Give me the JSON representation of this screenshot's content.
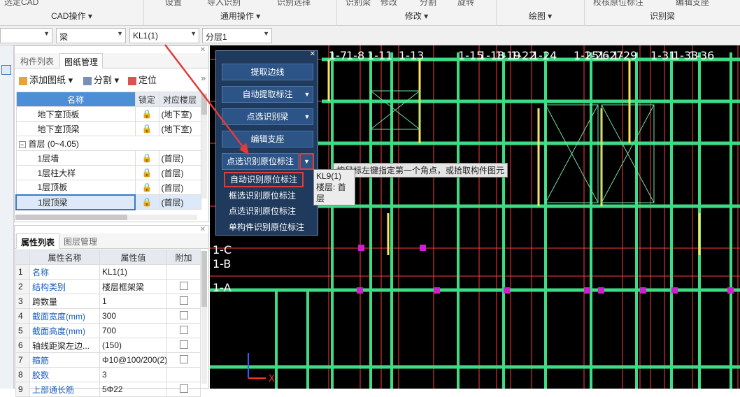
{
  "ribbon": {
    "top_labels": [
      "选定CAD",
      "设置",
      "导入识别",
      "识别选择",
      "识别梁",
      "修改",
      "分割",
      "旋转",
      "校核原位标注",
      "编辑支座"
    ],
    "groups": [
      {
        "label": "CAD操作"
      },
      {
        "label": "通用操作"
      },
      {
        "label": "修改"
      },
      {
        "label": "绘图"
      },
      {
        "label": "识别梁"
      }
    ]
  },
  "filter": {
    "floor": "",
    "type": "梁",
    "component": "KL1(1)",
    "layer": "分层1"
  },
  "drawing_panel": {
    "tabs": [
      "构件列表",
      "图纸管理"
    ],
    "toolbar": [
      "添加图纸",
      "分割",
      "定位"
    ],
    "headers": [
      "名称",
      "锁定",
      "对应楼层"
    ],
    "rows": [
      {
        "name": "地下室顶板",
        "floor": "(地下室)"
      },
      {
        "name": "地下室顶梁",
        "floor": "(地下室)"
      },
      {
        "name": "首层 (0~4.05)",
        "group": true
      },
      {
        "name": "1层墙",
        "floor": "(首层)"
      },
      {
        "name": "1层柱大样",
        "floor": "(首层)"
      },
      {
        "name": "1层顶板",
        "floor": "(首层)"
      },
      {
        "name": "1层顶梁",
        "floor": "(首层)",
        "selected": true
      }
    ]
  },
  "props_panel": {
    "tabs": [
      "属性列表",
      "图层管理"
    ],
    "headers": [
      "属性名称",
      "属性值",
      "附加"
    ],
    "rows": [
      {
        "n": "1",
        "name": "名称",
        "value": "KL1(1)",
        "blue": true,
        "check": false
      },
      {
        "n": "2",
        "name": "结构类别",
        "value": "楼层框架梁",
        "blue": true,
        "check": true
      },
      {
        "n": "3",
        "name": "跨数量",
        "value": "1",
        "blue": false,
        "check": true
      },
      {
        "n": "4",
        "name": "截面宽度(mm)",
        "value": "300",
        "blue": true,
        "check": true
      },
      {
        "n": "5",
        "name": "截面高度(mm)",
        "value": "700",
        "blue": true,
        "check": true
      },
      {
        "n": "6",
        "name": "轴线距梁左边...",
        "value": "(150)",
        "blue": false,
        "check": true
      },
      {
        "n": "7",
        "name": "箍筋",
        "value": "Φ10@100/200(2)",
        "blue": true,
        "check": true
      },
      {
        "n": "8",
        "name": "胶数",
        "value": "3",
        "blue": true,
        "check": false
      },
      {
        "n": "9",
        "name": "上部通长筋",
        "value": "5Φ22",
        "blue": true,
        "check": true
      }
    ]
  },
  "popup": {
    "buttons": [
      "提取边线",
      "自动提取标注",
      "点选识别梁",
      "编辑支座",
      "点选识别原位标注"
    ],
    "menu": [
      "自动识别原位标注",
      "框选识别原位标注",
      "点选识别原位标注",
      "单构件识别原位标注"
    ]
  },
  "canvas": {
    "axis_labels": [
      "1-7",
      "1-8",
      "1-11",
      "1-13",
      "1-15",
      "1-18",
      "1-19",
      "1-22",
      "1-24",
      "1-25",
      "1-26",
      "1-27",
      "1-29",
      "1-31",
      "1-33",
      "1-36"
    ],
    "row_labels": [
      "1-C",
      "1-B",
      "1-A"
    ],
    "tooltip_hint": "按鼠标左键指定第一个角点，或拾取构件图元",
    "tooltip_name": "KL9(1)",
    "tooltip_floor": "楼层: 首层",
    "axis_x": "X",
    "colors": {
      "beam": "#3ddc84",
      "wall": "#ffe45c",
      "grid": "#ff3b3b",
      "text": "#ffffff"
    }
  }
}
